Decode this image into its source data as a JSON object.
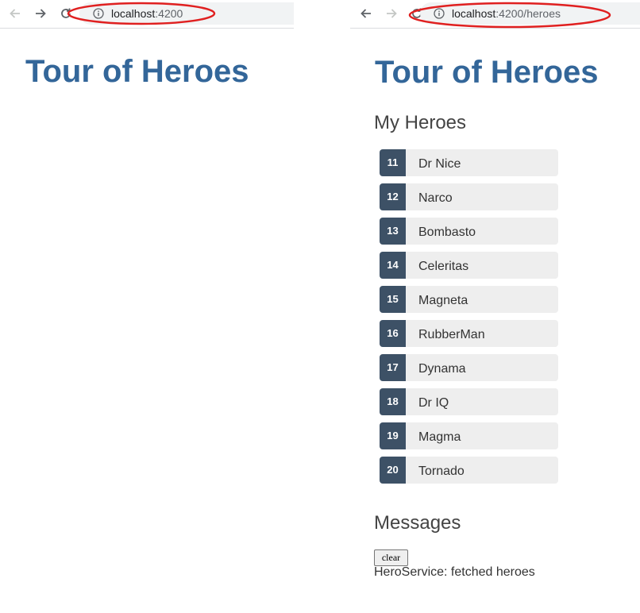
{
  "left_window": {
    "toolbar": {
      "back_icon": "back-arrow-icon",
      "forward_icon": "forward-arrow-icon",
      "reload_icon": "reload-icon",
      "info_icon": "info-icon",
      "url_host": "localhost",
      "url_path": ":4200"
    },
    "app_title": "Tour of Heroes"
  },
  "right_window": {
    "toolbar": {
      "back_icon": "back-arrow-icon",
      "forward_icon": "forward-arrow-icon",
      "reload_icon": "reload-icon",
      "info_icon": "info-icon",
      "url_host": "localhost",
      "url_path": ":4200/heroes"
    },
    "app_title": "Tour of Heroes",
    "heroes_title": "My Heroes",
    "heroes": [
      {
        "id": "11",
        "name": "Dr Nice"
      },
      {
        "id": "12",
        "name": "Narco"
      },
      {
        "id": "13",
        "name": "Bombasto"
      },
      {
        "id": "14",
        "name": "Celeritas"
      },
      {
        "id": "15",
        "name": "Magneta"
      },
      {
        "id": "16",
        "name": "RubberMan"
      },
      {
        "id": "17",
        "name": "Dynama"
      },
      {
        "id": "18",
        "name": "Dr IQ"
      },
      {
        "id": "19",
        "name": "Magma"
      },
      {
        "id": "20",
        "name": "Tornado"
      }
    ],
    "messages_title": "Messages",
    "clear_label": "clear",
    "messages": [
      "HeroService: fetched heroes"
    ]
  },
  "colors": {
    "title": "#336699",
    "badge": "#3d5166",
    "item_bg": "#eeeeee",
    "annotation": "#e02020"
  }
}
